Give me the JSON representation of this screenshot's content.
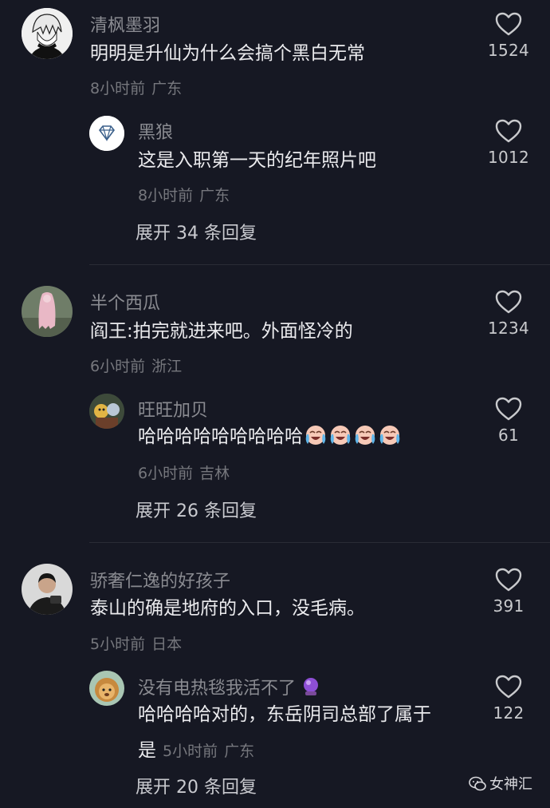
{
  "threads": [
    {
      "main": {
        "username": "清枫墨羽",
        "text": "明明是升仙为什么会搞个黑白无常",
        "time": "8小时前",
        "location": "广东",
        "likes": "1524",
        "avatar_icon": "anime-boy-avatar"
      },
      "reply": {
        "username": "黑狼",
        "text": "这是入职第一天的纪年照片吧",
        "time": "8小时前",
        "location": "广东",
        "likes": "1012",
        "avatar_icon": "diamond-avatar"
      },
      "expand_label": "展开 34 条回复"
    },
    {
      "main": {
        "username": "半个西瓜",
        "text": "阎王:拍完就进来吧。外面怪冷的",
        "time": "6小时前",
        "location": "浙江",
        "likes": "1234",
        "avatar_icon": "ghost-figure-avatar"
      },
      "reply": {
        "username": "旺旺加贝",
        "text": "哈哈哈哈哈哈哈哈哈",
        "time": "6小时前",
        "location": "吉林",
        "likes": "61",
        "avatar_icon": "cartoon-avatar",
        "emoji_count": 4,
        "emoji_icon": "crying-laughing-emoji"
      },
      "expand_label": "展开 26 条回复"
    },
    {
      "main": {
        "username": "骄奢仁逸的好孩子",
        "text": "泰山的确是地府的入口，没毛病。",
        "time": "5小时前",
        "location": "日本",
        "likes": "391",
        "avatar_icon": "man-photo-avatar"
      },
      "reply": {
        "username": "没有电热毯我活不了",
        "username_emoji": "crystal-ball-emoji",
        "text": "哈哈哈哈对的，东岳阴司总部了属于",
        "text_line2": "是",
        "time": "5小时前",
        "location": "广东",
        "likes": "122",
        "avatar_icon": "lion-avatar"
      },
      "expand_label": "展开 20 条回复"
    }
  ],
  "watermark": {
    "label": "女神汇",
    "icon": "wechat-icon"
  },
  "colors": {
    "background": "#161823",
    "username": "#8a8b91",
    "text": "#ebebee",
    "meta": "#76777d",
    "likes": "#c9cacd"
  }
}
